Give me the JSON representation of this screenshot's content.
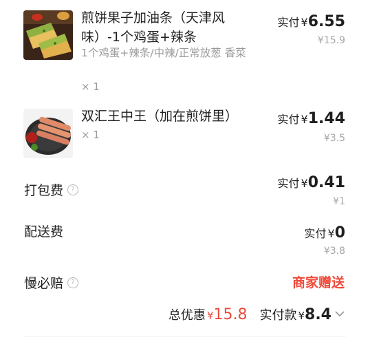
{
  "items": [
    {
      "title": "煎饼果子加油条（天津风味）-1个鸡蛋+辣条",
      "spec": "1个鸡蛋+辣条/中辣/正常放葱 香菜",
      "qty": "× 1",
      "pay_label": "实付",
      "currency": "¥",
      "pay_amount": "6.55",
      "original": "¥15.9"
    },
    {
      "title": "双汇王中王（加在煎饼里）",
      "qty": "× 1",
      "pay_label": "实付",
      "currency": "¥",
      "pay_amount": "1.44",
      "original": "¥3.5"
    }
  ],
  "fees": {
    "packing": {
      "label": "打包费",
      "pay_label": "实付",
      "currency": "¥",
      "amount": "0.41",
      "original": "¥1"
    },
    "delivery": {
      "label": "配送费",
      "pay_label": "实付",
      "currency": "¥",
      "amount": "0",
      "original": "¥3.8"
    },
    "compensation": {
      "label": "慢必赔",
      "value": "商家赠送"
    }
  },
  "summary": {
    "discount_label": "总优惠",
    "currency": "¥",
    "discount_amount": "15.8",
    "pay_label": "实付款",
    "pay_amount": "8.4"
  },
  "icons": {
    "help": "question-circle-icon",
    "expand": "chevron-down-icon"
  },
  "colors": {
    "accent_red": "#ef4a3a",
    "muted": "#a6a6a6"
  }
}
